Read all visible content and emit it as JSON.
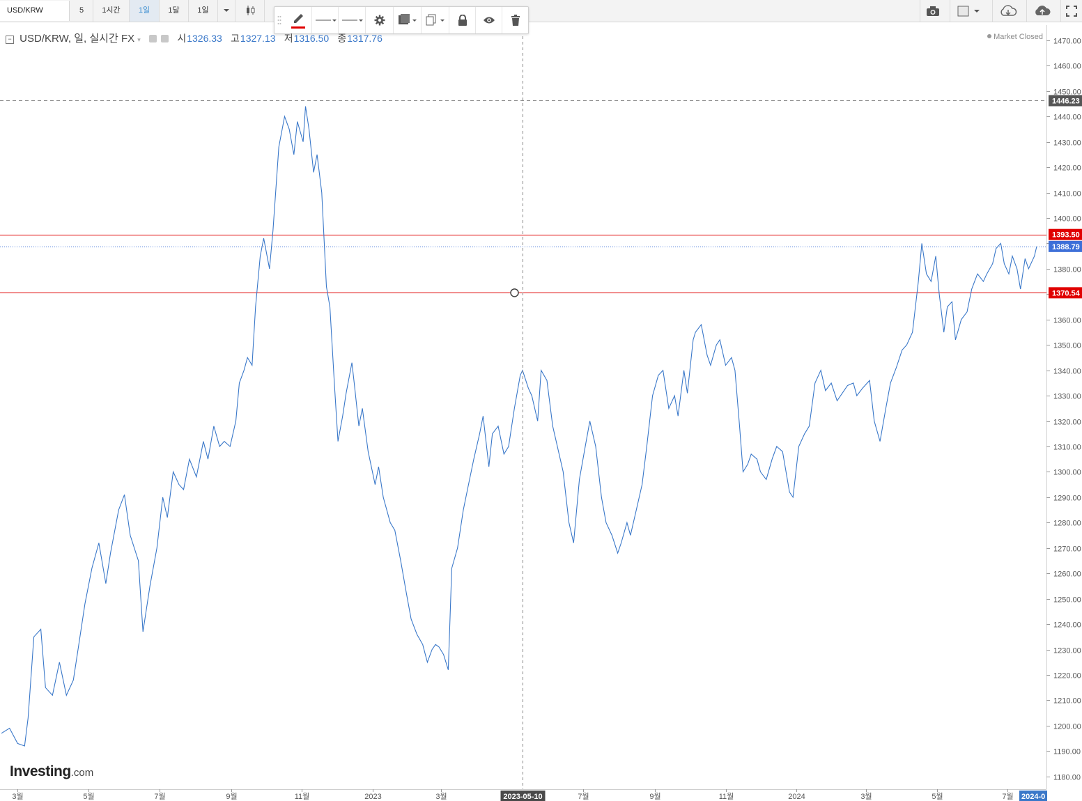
{
  "toolbar": {
    "symbol": "USD/KRW",
    "intervals": [
      {
        "label": "5",
        "active": false
      },
      {
        "label": "1시간",
        "active": false
      },
      {
        "label": "1일",
        "active": true
      },
      {
        "label": "1달",
        "active": false
      },
      {
        "label": "1일",
        "active": false
      }
    ],
    "right_icons": [
      "camera-icon",
      "color-square-icon",
      "cloud-download-icon",
      "cloud-upload-icon",
      "fullscreen-icon"
    ]
  },
  "drawing_toolbar": {
    "items": [
      "drag-handle-icon",
      "pencil-icon",
      "line-style-icon",
      "line-width-icon",
      "settings-gear-icon",
      "fill-color-icon",
      "clone-icon",
      "lock-icon",
      "visibility-eye-icon",
      "trash-icon"
    ],
    "accent_color": "#e00000"
  },
  "legend": {
    "title": "USD/KRW, 일, 실시간 FX",
    "open_label": "시",
    "open": "1326.33",
    "high_label": "고",
    "high": "1327.13",
    "low_label": "저",
    "low": "1316.50",
    "close_label": "종",
    "close": "1317.76"
  },
  "status": "Market Closed",
  "logo": {
    "main": "Investing",
    "suffix": ".com"
  },
  "chart_data": {
    "type": "line",
    "series_color": "#3a78c9",
    "y_axis": {
      "ticks": [
        1180,
        1190,
        1200,
        1210,
        1220,
        1230,
        1240,
        1250,
        1260,
        1270,
        1280,
        1290,
        1300,
        1310,
        1320,
        1330,
        1340,
        1350,
        1360,
        1370,
        1380,
        1390,
        1400,
        1410,
        1420,
        1430,
        1440,
        1450,
        1460,
        1470
      ],
      "range": [
        1175,
        1476
      ]
    },
    "x_axis": {
      "ticks": [
        {
          "label": "3월",
          "date": "2022-03-01"
        },
        {
          "label": "5월",
          "date": "2022-05-01"
        },
        {
          "label": "7월",
          "date": "2022-07-01"
        },
        {
          "label": "9월",
          "date": "2022-09-01"
        },
        {
          "label": "11월",
          "date": "2022-11-01"
        },
        {
          "label": "2023",
          "date": "2023-01-01"
        },
        {
          "label": "3월",
          "date": "2023-03-01"
        },
        {
          "label": "7월",
          "date": "2023-07-01"
        },
        {
          "label": "9월",
          "date": "2023-09-01"
        },
        {
          "label": "11월",
          "date": "2023-11-01"
        },
        {
          "label": "2024",
          "date": "2024-01-01"
        },
        {
          "label": "3월",
          "date": "2024-03-01"
        },
        {
          "label": "5월",
          "date": "2024-05-01"
        },
        {
          "label": "7월",
          "date": "2024-07-01"
        }
      ],
      "range": [
        "2022-02-15",
        "2024-07-26"
      ]
    },
    "crosshair": {
      "date_label": "2023-05-10",
      "date": "2023-05-10",
      "value": 1370.54
    },
    "right_date_badge": "2024-0",
    "horizontal_lines": [
      {
        "value": 1446.23,
        "label": "1446.23",
        "style": "dashed",
        "color": "#888888"
      },
      {
        "value": 1393.5,
        "label": "1393.50",
        "style": "solid",
        "color": "#e00000"
      },
      {
        "value": 1370.54,
        "label": "1370.54",
        "style": "solid",
        "color": "#e00000"
      },
      {
        "value": 1388.79,
        "label": "1388.79",
        "style": "dotted",
        "color": "#3d6fd8"
      }
    ],
    "points": [
      [
        "2022-02-15",
        1197
      ],
      [
        "2022-02-22",
        1199
      ],
      [
        "2022-03-01",
        1193
      ],
      [
        "2022-03-07",
        1192
      ],
      [
        "2022-03-10",
        1203
      ],
      [
        "2022-03-15",
        1235
      ],
      [
        "2022-03-21",
        1238
      ],
      [
        "2022-03-25",
        1215
      ],
      [
        "2022-03-31",
        1212
      ],
      [
        "2022-04-06",
        1225
      ],
      [
        "2022-04-12",
        1212
      ],
      [
        "2022-04-18",
        1218
      ],
      [
        "2022-04-22",
        1230
      ],
      [
        "2022-04-28",
        1248
      ],
      [
        "2022-05-04",
        1262
      ],
      [
        "2022-05-10",
        1272
      ],
      [
        "2022-05-16",
        1256
      ],
      [
        "2022-05-20",
        1268
      ],
      [
        "2022-05-27",
        1285
      ],
      [
        "2022-06-01",
        1291
      ],
      [
        "2022-06-06",
        1275
      ],
      [
        "2022-06-13",
        1265
      ],
      [
        "2022-06-17",
        1237
      ],
      [
        "2022-06-23",
        1255
      ],
      [
        "2022-06-29",
        1270
      ],
      [
        "2022-07-04",
        1290
      ],
      [
        "2022-07-08",
        1282
      ],
      [
        "2022-07-13",
        1300
      ],
      [
        "2022-07-18",
        1295
      ],
      [
        "2022-07-22",
        1293
      ],
      [
        "2022-07-27",
        1305
      ],
      [
        "2022-08-02",
        1298
      ],
      [
        "2022-08-08",
        1312
      ],
      [
        "2022-08-12",
        1305
      ],
      [
        "2022-08-17",
        1318
      ],
      [
        "2022-08-22",
        1310
      ],
      [
        "2022-08-26",
        1312
      ],
      [
        "2022-08-31",
        1310
      ],
      [
        "2022-09-05",
        1320
      ],
      [
        "2022-09-08",
        1335
      ],
      [
        "2022-09-12",
        1340
      ],
      [
        "2022-09-15",
        1345
      ],
      [
        "2022-09-19",
        1342
      ],
      [
        "2022-09-22",
        1365
      ],
      [
        "2022-09-26",
        1385
      ],
      [
        "2022-09-29",
        1392
      ],
      [
        "2022-10-04",
        1380
      ],
      [
        "2022-10-07",
        1395
      ],
      [
        "2022-10-12",
        1428
      ],
      [
        "2022-10-17",
        1440
      ],
      [
        "2022-10-21",
        1435
      ],
      [
        "2022-10-25",
        1425
      ],
      [
        "2022-10-28",
        1438
      ],
      [
        "2022-11-02",
        1430
      ],
      [
        "2022-11-04",
        1444
      ],
      [
        "2022-11-07",
        1435
      ],
      [
        "2022-11-11",
        1418
      ],
      [
        "2022-11-14",
        1425
      ],
      [
        "2022-11-18",
        1410
      ],
      [
        "2022-11-22",
        1373
      ],
      [
        "2022-11-25",
        1365
      ],
      [
        "2022-11-29",
        1334
      ],
      [
        "2022-12-02",
        1312
      ],
      [
        "2022-12-06",
        1322
      ],
      [
        "2022-12-09",
        1331
      ],
      [
        "2022-12-14",
        1343
      ],
      [
        "2022-12-16",
        1335
      ],
      [
        "2022-12-20",
        1318
      ],
      [
        "2022-12-23",
        1325
      ],
      [
        "2022-12-28",
        1308
      ],
      [
        "2023-01-03",
        1295
      ],
      [
        "2023-01-06",
        1302
      ],
      [
        "2023-01-10",
        1290
      ],
      [
        "2023-01-16",
        1280
      ],
      [
        "2023-01-20",
        1277
      ],
      [
        "2023-01-25",
        1265
      ],
      [
        "2023-01-30",
        1252
      ],
      [
        "2023-02-03",
        1242
      ],
      [
        "2023-02-08",
        1236
      ],
      [
        "2023-02-13",
        1232
      ],
      [
        "2023-02-17",
        1225
      ],
      [
        "2023-02-21",
        1230
      ],
      [
        "2023-02-24",
        1232
      ],
      [
        "2023-02-27",
        1231
      ],
      [
        "2023-03-03",
        1228
      ],
      [
        "2023-03-07",
        1222
      ],
      [
        "2023-03-10",
        1262
      ],
      [
        "2023-03-15",
        1270
      ],
      [
        "2023-03-20",
        1285
      ],
      [
        "2023-03-24",
        1294
      ],
      [
        "2023-03-29",
        1305
      ],
      [
        "2023-04-03",
        1315
      ],
      [
        "2023-04-06",
        1322
      ],
      [
        "2023-04-11",
        1302
      ],
      [
        "2023-04-14",
        1315
      ],
      [
        "2023-04-19",
        1318
      ],
      [
        "2023-04-24",
        1307
      ],
      [
        "2023-04-28",
        1310
      ],
      [
        "2023-05-03",
        1325
      ],
      [
        "2023-05-08",
        1338
      ],
      [
        "2023-05-10",
        1340
      ],
      [
        "2023-05-15",
        1333
      ],
      [
        "2023-05-18",
        1330
      ],
      [
        "2023-05-23",
        1320
      ],
      [
        "2023-05-26",
        1340
      ],
      [
        "2023-05-31",
        1336
      ],
      [
        "2023-06-05",
        1318
      ],
      [
        "2023-06-09",
        1310
      ],
      [
        "2023-06-14",
        1300
      ],
      [
        "2023-06-19",
        1280
      ],
      [
        "2023-06-23",
        1272
      ],
      [
        "2023-06-28",
        1297
      ],
      [
        "2023-07-03",
        1310
      ],
      [
        "2023-07-07",
        1320
      ],
      [
        "2023-07-12",
        1310
      ],
      [
        "2023-07-17",
        1290
      ],
      [
        "2023-07-21",
        1280
      ],
      [
        "2023-07-26",
        1275
      ],
      [
        "2023-07-31",
        1268
      ],
      [
        "2023-08-03",
        1272
      ],
      [
        "2023-08-08",
        1280
      ],
      [
        "2023-08-11",
        1275
      ],
      [
        "2023-08-16",
        1285
      ],
      [
        "2023-08-21",
        1295
      ],
      [
        "2023-08-25",
        1310
      ],
      [
        "2023-08-30",
        1330
      ],
      [
        "2023-09-04",
        1338
      ],
      [
        "2023-09-08",
        1340
      ],
      [
        "2023-09-13",
        1325
      ],
      [
        "2023-09-18",
        1330
      ],
      [
        "2023-09-21",
        1322
      ],
      [
        "2023-09-26",
        1340
      ],
      [
        "2023-09-29",
        1331
      ],
      [
        "2023-10-04",
        1352
      ],
      [
        "2023-10-06",
        1355
      ],
      [
        "2023-10-11",
        1358
      ],
      [
        "2023-10-16",
        1346
      ],
      [
        "2023-10-19",
        1342
      ],
      [
        "2023-10-24",
        1350
      ],
      [
        "2023-10-27",
        1352
      ],
      [
        "2023-11-01",
        1342
      ],
      [
        "2023-11-06",
        1345
      ],
      [
        "2023-11-09",
        1340
      ],
      [
        "2023-11-13",
        1318
      ],
      [
        "2023-11-16",
        1300
      ],
      [
        "2023-11-20",
        1303
      ],
      [
        "2023-11-23",
        1307
      ],
      [
        "2023-11-28",
        1305
      ],
      [
        "2023-12-01",
        1300
      ],
      [
        "2023-12-06",
        1297
      ],
      [
        "2023-12-11",
        1305
      ],
      [
        "2023-12-15",
        1310
      ],
      [
        "2023-12-20",
        1308
      ],
      [
        "2023-12-26",
        1292
      ],
      [
        "2023-12-29",
        1290
      ],
      [
        "2024-01-03",
        1310
      ],
      [
        "2024-01-08",
        1315
      ],
      [
        "2024-01-12",
        1318
      ],
      [
        "2024-01-17",
        1335
      ],
      [
        "2024-01-22",
        1340
      ],
      [
        "2024-01-26",
        1332
      ],
      [
        "2024-01-31",
        1335
      ],
      [
        "2024-02-05",
        1328
      ],
      [
        "2024-02-08",
        1330
      ],
      [
        "2024-02-14",
        1334
      ],
      [
        "2024-02-19",
        1335
      ],
      [
        "2024-02-22",
        1330
      ],
      [
        "2024-02-27",
        1333
      ],
      [
        "2024-03-04",
        1336
      ],
      [
        "2024-03-08",
        1320
      ],
      [
        "2024-03-13",
        1312
      ],
      [
        "2024-03-18",
        1325
      ],
      [
        "2024-03-22",
        1335
      ],
      [
        "2024-03-27",
        1341
      ],
      [
        "2024-04-01",
        1348
      ],
      [
        "2024-04-05",
        1350
      ],
      [
        "2024-04-10",
        1355
      ],
      [
        "2024-04-15",
        1375
      ],
      [
        "2024-04-18",
        1390
      ],
      [
        "2024-04-22",
        1378
      ],
      [
        "2024-04-26",
        1375
      ],
      [
        "2024-04-30",
        1385
      ],
      [
        "2024-05-03",
        1370
      ],
      [
        "2024-05-07",
        1355
      ],
      [
        "2024-05-10",
        1365
      ],
      [
        "2024-05-14",
        1367
      ],
      [
        "2024-05-17",
        1352
      ],
      [
        "2024-05-22",
        1360
      ],
      [
        "2024-05-27",
        1363
      ],
      [
        "2024-05-31",
        1372
      ],
      [
        "2024-06-05",
        1378
      ],
      [
        "2024-06-10",
        1375
      ],
      [
        "2024-06-13",
        1378
      ],
      [
        "2024-06-18",
        1382
      ],
      [
        "2024-06-21",
        1388
      ],
      [
        "2024-06-25",
        1390
      ],
      [
        "2024-06-28",
        1382
      ],
      [
        "2024-07-02",
        1378
      ],
      [
        "2024-07-05",
        1385
      ],
      [
        "2024-07-09",
        1380
      ],
      [
        "2024-07-12",
        1372
      ],
      [
        "2024-07-16",
        1384
      ],
      [
        "2024-07-19",
        1380
      ],
      [
        "2024-07-24",
        1385
      ],
      [
        "2024-07-26",
        1388.79
      ]
    ]
  }
}
